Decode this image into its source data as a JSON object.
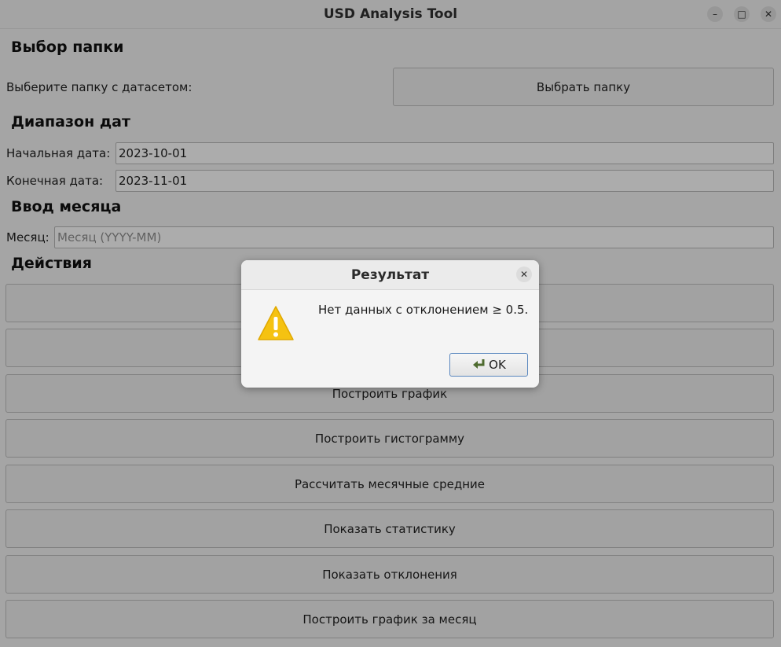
{
  "window": {
    "title": "USD Analysis Tool",
    "minimize": "–",
    "maximize": "□",
    "close": "✕"
  },
  "folder": {
    "heading": "Выбор папки",
    "label": "Выберите папку с датасетом:",
    "button": "Выбрать папку"
  },
  "dates": {
    "heading": "Диапазон дат",
    "start_label": "Начальная дата:",
    "start_value": "2023-10-01",
    "end_label": "Конечная дата:",
    "end_value": "2023-11-01"
  },
  "month": {
    "heading": "Ввод месяца",
    "label": "Месяц:",
    "placeholder": "Месяц (YYYY-MM)"
  },
  "actions": {
    "heading": "Действия",
    "buttons": [
      "",
      "",
      "Построить график",
      "Построить гистограмму",
      "Рассчитать месячные средние",
      "Показать статистику",
      "Показать отклонения",
      "Построить график за месяц"
    ]
  },
  "dialog": {
    "title": "Результат",
    "close": "✕",
    "message": "Нет данных с отклонением ≥ 0.5.",
    "ok": "OK",
    "icon": "warning-icon",
    "icon_color": "#f5c211"
  }
}
